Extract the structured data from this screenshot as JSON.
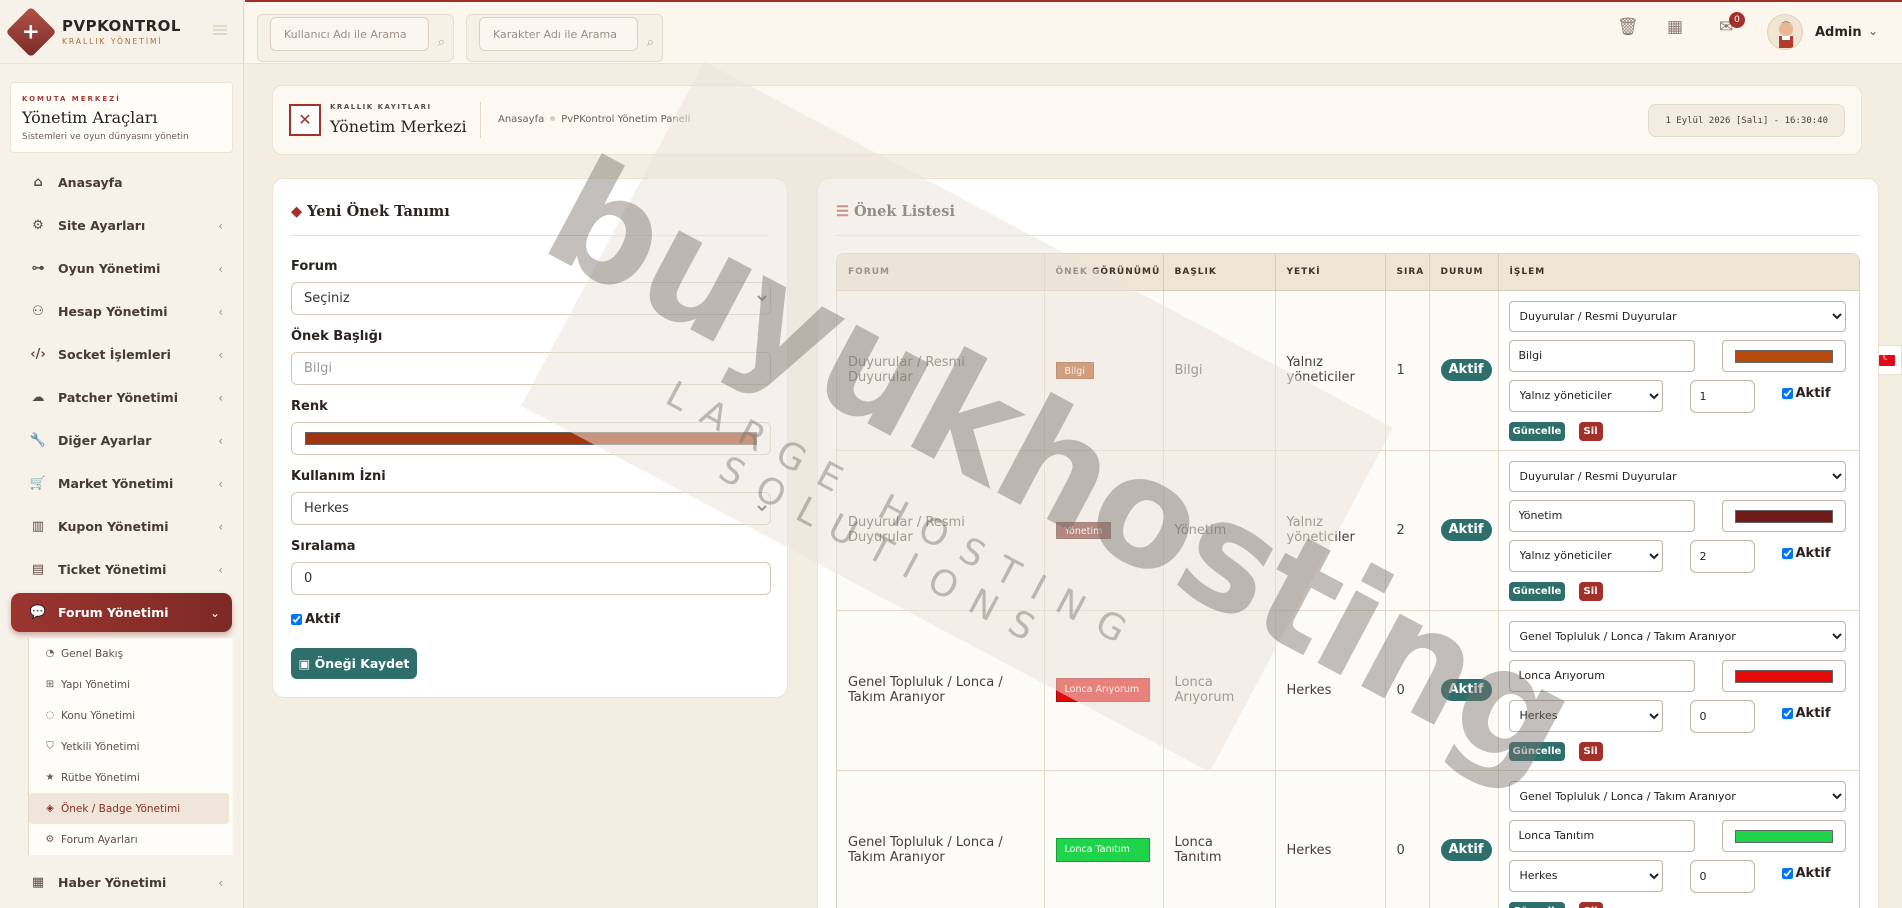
{
  "brand": {
    "title": "PVPKONTROL",
    "subtitle": "KRALLIK YÖNETİMİ"
  },
  "topbar": {
    "search_user_placeholder": "Kullanıcı Adı ile Arama",
    "search_char_placeholder": "Karakter Adı ile Arama",
    "notification_count": "0",
    "admin_name": "Admin"
  },
  "sidebar": {
    "card": {
      "kicker": "KOMUTA MERKEZİ",
      "title": "Yönetim Araçları",
      "desc": "Sistemleri ve oyun dünyasını yönetin"
    },
    "items": [
      {
        "label": "Anasayfa",
        "icon": "home-icon"
      },
      {
        "label": "Site Ayarları",
        "icon": "gear-icon"
      },
      {
        "label": "Oyun Yönetimi",
        "icon": "gamepad-icon"
      },
      {
        "label": "Hesap Yönetimi",
        "icon": "users-icon"
      },
      {
        "label": "Socket İşlemleri",
        "icon": "code-icon"
      },
      {
        "label": "Patcher Yönetimi",
        "icon": "cloud-icon"
      },
      {
        "label": "Diğer Ayarlar",
        "icon": "wrench-icon"
      },
      {
        "label": "Market Yönetimi",
        "icon": "cart-icon"
      },
      {
        "label": "Kupon Yönetimi",
        "icon": "barcode-icon"
      },
      {
        "label": "Ticket Yönetimi",
        "icon": "ticket-icon"
      },
      {
        "label": "Forum Yönetimi",
        "icon": "comments-icon"
      },
      {
        "label": "Haber Yönetimi",
        "icon": "news-icon"
      }
    ],
    "forum_sub": [
      {
        "label": "Genel Bakış",
        "icon": "dashboard-icon"
      },
      {
        "label": "Yapı Yönetimi",
        "icon": "sitemap-icon"
      },
      {
        "label": "Konu Yönetimi",
        "icon": "comment-icon"
      },
      {
        "label": "Yetkili Yönetimi",
        "icon": "shield-icon"
      },
      {
        "label": "Rütbe Yönetimi",
        "icon": "star-icon"
      },
      {
        "label": "Önek / Badge Yönetimi",
        "icon": "tags-icon"
      },
      {
        "label": "Forum Ayarları",
        "icon": "cogs-icon"
      }
    ]
  },
  "page_header": {
    "kicker": "KRALLIK KAYITLARI",
    "title": "Yönetim Merkezi",
    "breadcrumb_home": "Anasayfa",
    "breadcrumb_current": "PvPKontrol Yönetim Paneli",
    "datetime": "1 Eylül 2026 [Salı] - 16:30:40"
  },
  "form": {
    "title": "Yeni Önek Tanımı",
    "forum_label": "Forum",
    "forum_value": "Seçiniz",
    "prefix_label": "Önek Başlığı",
    "prefix_placeholder": "Bilgi",
    "color_label": "Renk",
    "color_value": "#a0350f",
    "permission_label": "Kullanım İzni",
    "permission_value": "Herkes",
    "order_label": "Sıralama",
    "order_value": "0",
    "active_label": "Aktif",
    "save_label": "Öneği Kaydet"
  },
  "list": {
    "title": "Önek Listesi",
    "columns": [
      "FORUM",
      "ÖNEK GÖRÜNÜMÜ",
      "BAŞLIK",
      "YETKİ",
      "SIRA",
      "DURUM",
      "İŞLEM"
    ],
    "rows": [
      {
        "forum": "Duyurular / Resmi Duyurular",
        "badge": "Bilgi",
        "color": "#b44a0c",
        "title": "Bilgi",
        "permission": "Yalnız yöneticiler",
        "order": "1",
        "status": "Aktif"
      },
      {
        "forum": "Duyurular / Resmi Duyurular",
        "badge": "Yönetim",
        "color": "#6e1a16",
        "title": "Yönetim",
        "permission": "Yalnız yöneticiler",
        "order": "2",
        "status": "Aktif"
      },
      {
        "forum": "Genel Topluluk / Lonca / Takım Aranıyor",
        "badge": "Lonca Arıyorum",
        "color": "#e30a0a",
        "title": "Lonca Arıyorum",
        "permission": "Herkes",
        "order": "0",
        "status": "Aktif"
      },
      {
        "forum": "Genel Topluluk / Lonca / Takım Aranıyor",
        "badge": "Lonca Tanıtım",
        "color": "#1fd44a",
        "title": "Lonca Tanıtım",
        "permission": "Herkes",
        "order": "0",
        "status": "Aktif"
      }
    ],
    "update_label": "Güncelle",
    "delete_label": "Sil",
    "active_label": "Aktif"
  },
  "watermark": {
    "main": "buyukhosting",
    "sub": "LARGE HOSTING SOLUTIONS"
  },
  "colors": {
    "accent": "#a3302a",
    "teal": "#2e6f6c"
  }
}
